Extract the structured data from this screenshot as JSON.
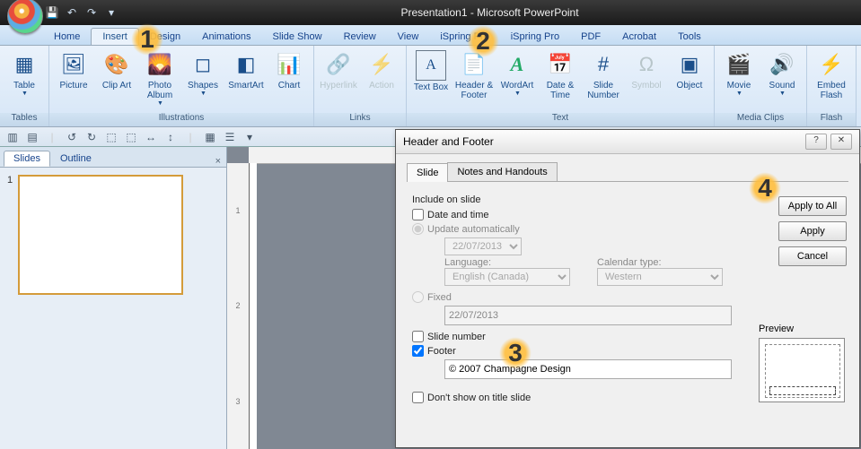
{
  "title": "Presentation1 - Microsoft PowerPoint",
  "tabs": [
    "Home",
    "Insert",
    "Design",
    "Animations",
    "Slide Show",
    "Review",
    "View",
    "iSpring Pro",
    "iSpring Pro",
    "PDF",
    "Acrobat",
    "Tools"
  ],
  "active_tab": "Insert",
  "ribbon_groups": {
    "tables": {
      "label": "Tables",
      "items": [
        {
          "name": "Table",
          "icon": "▦"
        }
      ]
    },
    "illustrations": {
      "label": "Illustrations",
      "items": [
        {
          "name": "Picture",
          "icon": "🖼"
        },
        {
          "name": "Clip Art",
          "icon": "🎨"
        },
        {
          "name": "Photo Album",
          "icon": "🌄"
        },
        {
          "name": "Shapes",
          "icon": "◻"
        },
        {
          "name": "SmartArt",
          "icon": "◧"
        },
        {
          "name": "Chart",
          "icon": "📊"
        }
      ]
    },
    "links": {
      "label": "Links",
      "items": [
        {
          "name": "Hyperlink",
          "icon": "🔗",
          "disabled": true
        },
        {
          "name": "Action",
          "icon": "⚡",
          "disabled": true
        }
      ]
    },
    "text": {
      "label": "Text",
      "items": [
        {
          "name": "Text Box",
          "icon": "A"
        },
        {
          "name": "Header & Footer",
          "icon": "📄"
        },
        {
          "name": "WordArt",
          "icon": "A"
        },
        {
          "name": "Date & Time",
          "icon": "📅"
        },
        {
          "name": "Slide Number",
          "icon": "#"
        },
        {
          "name": "Symbol",
          "icon": "Ω",
          "disabled": true
        },
        {
          "name": "Object",
          "icon": "▣"
        }
      ]
    },
    "media": {
      "label": "Media Clips",
      "items": [
        {
          "name": "Movie",
          "icon": "🎬"
        },
        {
          "name": "Sound",
          "icon": "🔊"
        }
      ]
    },
    "flash": {
      "label": "Flash",
      "items": [
        {
          "name": "Embed Flash",
          "icon": "⚡"
        }
      ]
    }
  },
  "side_tabs": {
    "slides": "Slides",
    "outline": "Outline"
  },
  "dialog": {
    "title": "Header and Footer",
    "tabs": {
      "slide": "Slide",
      "notes": "Notes and Handouts"
    },
    "include_label": "Include on slide",
    "date_time": "Date and time",
    "update_auto": "Update automatically",
    "date_value": "22/07/2013",
    "language_label": "Language:",
    "language_value": "English (Canada)",
    "calendar_label": "Calendar type:",
    "calendar_value": "Western",
    "fixed": "Fixed",
    "fixed_value": "22/07/2013",
    "slide_number": "Slide number",
    "footer": "Footer",
    "footer_value": "© 2007 Champagne Design",
    "dont_show": "Don't show on title slide",
    "apply_all": "Apply to All",
    "apply": "Apply",
    "cancel": "Cancel",
    "preview": "Preview"
  },
  "annotations": {
    "a1": "1",
    "a2": "2",
    "a3": "3",
    "a4": "4"
  }
}
